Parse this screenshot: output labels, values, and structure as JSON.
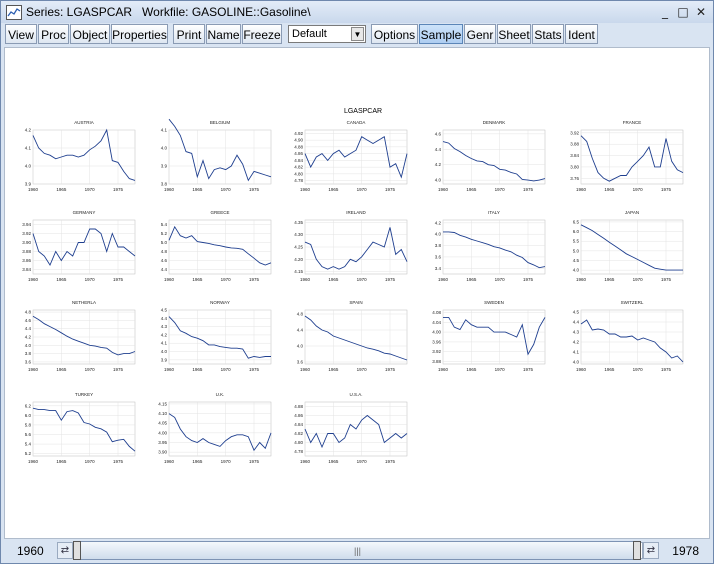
{
  "window": {
    "title": "Series: LGASPCAR   Workfile: GASOLINE::Gasoline\\",
    "minimize_glyph": "_",
    "maximize_glyph": "□",
    "close_glyph": "✕"
  },
  "toolbar": {
    "buttons": [
      {
        "label": "View"
      },
      {
        "label": "Proc"
      },
      {
        "label": "Object"
      },
      {
        "label": "Properties"
      },
      {
        "label": "Print"
      },
      {
        "label": "Name"
      },
      {
        "label": "Freeze"
      },
      {
        "label": "Options"
      },
      {
        "label": "Sample"
      },
      {
        "label": "Genr"
      },
      {
        "label": "Sheet"
      },
      {
        "label": "Stats"
      },
      {
        "label": "Ident"
      }
    ],
    "dropdown_value": "Default"
  },
  "chart_title": "LGASPCAR",
  "bottom": {
    "range_start": "1960",
    "range_end": "1978",
    "scroll_grip": "|||"
  },
  "chart_data": [
    {
      "type": "line",
      "title": "AUSTRIA",
      "x": [
        1960,
        1978
      ],
      "xticks": [
        "1960",
        "1965",
        "1970",
        "1975"
      ],
      "yticks": [
        "3.9",
        "4.0",
        "4.1",
        "4.2"
      ],
      "ylim": [
        3.9,
        4.2
      ],
      "values": [
        4.17,
        4.1,
        4.07,
        4.06,
        4.04,
        4.05,
        4.06,
        4.06,
        4.05,
        4.06,
        4.09,
        4.11,
        4.14,
        4.2,
        4.03,
        4.02,
        3.97,
        3.93,
        3.92
      ]
    },
    {
      "type": "line",
      "title": "BELGIUM",
      "x": [
        1960,
        1978
      ],
      "xticks": [
        "1960",
        "1965",
        "1970",
        "1975"
      ],
      "yticks": [
        "3.8",
        "3.9",
        "4.0",
        "4.1"
      ],
      "ylim": [
        3.8,
        4.1
      ],
      "values": [
        4.16,
        4.12,
        4.07,
        3.98,
        3.97,
        3.84,
        3.93,
        3.83,
        3.88,
        3.89,
        3.88,
        3.9,
        3.96,
        3.91,
        3.82,
        3.87,
        3.86,
        3.85,
        3.84
      ]
    },
    {
      "type": "line",
      "title": "CANADA",
      "x": [
        1960,
        1978
      ],
      "xticks": [
        "1960",
        "1965",
        "1970",
        "1975"
      ],
      "yticks": [
        "4.78",
        "4.80",
        "4.82",
        "4.84",
        "4.86",
        "4.88",
        "4.90",
        "4.92"
      ],
      "ylim": [
        4.77,
        4.93
      ],
      "values": [
        4.86,
        4.82,
        4.85,
        4.86,
        4.84,
        4.86,
        4.87,
        4.85,
        4.86,
        4.87,
        4.91,
        4.9,
        4.89,
        4.9,
        4.91,
        4.82,
        4.83,
        4.79,
        4.86
      ]
    },
    {
      "type": "line",
      "title": "DENMARK",
      "x": [
        1960,
        1978
      ],
      "xticks": [
        "1960",
        "1965",
        "1970",
        "1975"
      ],
      "yticks": [
        "4.0",
        "4.2",
        "4.4",
        "4.6"
      ],
      "ylim": [
        3.95,
        4.65
      ],
      "values": [
        4.5,
        4.48,
        4.41,
        4.37,
        4.32,
        4.28,
        4.25,
        4.24,
        4.2,
        4.19,
        4.14,
        4.13,
        4.1,
        4.08,
        4.01,
        4.0,
        3.99,
        4.0,
        4.02
      ]
    },
    {
      "type": "line",
      "title": "FRANCE",
      "x": [
        1960,
        1978
      ],
      "xticks": [
        "1960",
        "1965",
        "1970",
        "1975"
      ],
      "yticks": [
        "3.76",
        "3.80",
        "3.84",
        "3.88",
        "3.92"
      ],
      "ylim": [
        3.74,
        3.93
      ],
      "values": [
        3.91,
        3.89,
        3.83,
        3.78,
        3.76,
        3.75,
        3.76,
        3.77,
        3.77,
        3.8,
        3.82,
        3.84,
        3.87,
        3.8,
        3.8,
        3.9,
        3.82,
        3.79,
        3.78
      ]
    },
    {
      "type": "line",
      "title": "GERMANY",
      "x": [
        1960,
        1978
      ],
      "xticks": [
        "1960",
        "1965",
        "1970",
        "1975"
      ],
      "yticks": [
        "3.84",
        "3.86",
        "3.88",
        "3.90",
        "3.92",
        "3.94"
      ],
      "ylim": [
        3.83,
        3.95
      ],
      "values": [
        3.92,
        3.88,
        3.87,
        3.85,
        3.88,
        3.86,
        3.88,
        3.87,
        3.9,
        3.9,
        3.93,
        3.93,
        3.92,
        3.88,
        3.92,
        3.89,
        3.89,
        3.88,
        3.87
      ]
    },
    {
      "type": "line",
      "title": "GREECE",
      "x": [
        1960,
        1978
      ],
      "xticks": [
        "1960",
        "1965",
        "1970",
        "1975"
      ],
      "yticks": [
        "4.4",
        "4.6",
        "4.8",
        "5.0",
        "5.2",
        "5.4"
      ],
      "ylim": [
        4.3,
        5.5
      ],
      "values": [
        5.05,
        5.35,
        5.15,
        5.1,
        5.15,
        5.02,
        5.0,
        4.98,
        4.95,
        4.93,
        4.9,
        4.88,
        4.87,
        4.85,
        4.75,
        4.65,
        4.55,
        4.5,
        4.55
      ]
    },
    {
      "type": "line",
      "title": "IRELAND",
      "x": [
        1960,
        1978
      ],
      "xticks": [
        "1960",
        "1965",
        "1970",
        "1975"
      ],
      "yticks": [
        "4.15",
        "4.20",
        "4.25",
        "4.30",
        "4.35"
      ],
      "ylim": [
        4.14,
        4.36
      ],
      "values": [
        4.27,
        4.26,
        4.2,
        4.17,
        4.16,
        4.17,
        4.16,
        4.17,
        4.2,
        4.19,
        4.21,
        4.24,
        4.27,
        4.26,
        4.25,
        4.33,
        4.22,
        4.24,
        4.19
      ]
    },
    {
      "type": "line",
      "title": "ITALY",
      "x": [
        1960,
        1978
      ],
      "xticks": [
        "1960",
        "1965",
        "1970",
        "1975"
      ],
      "yticks": [
        "3.4",
        "3.6",
        "3.8",
        "4.0",
        "4.2"
      ],
      "ylim": [
        3.3,
        4.25
      ],
      "values": [
        4.04,
        4.04,
        4.03,
        3.98,
        3.95,
        3.91,
        3.88,
        3.85,
        3.82,
        3.78,
        3.76,
        3.72,
        3.69,
        3.63,
        3.59,
        3.5,
        3.46,
        3.41,
        3.43
      ]
    },
    {
      "type": "line",
      "title": "JAPAN",
      "x": [
        1960,
        1978
      ],
      "xticks": [
        "1960",
        "1965",
        "1970",
        "1975"
      ],
      "yticks": [
        "4.0",
        "4.5",
        "5.0",
        "5.5",
        "6.0",
        "6.5"
      ],
      "ylim": [
        3.8,
        6.6
      ],
      "values": [
        6.35,
        6.2,
        6.05,
        5.85,
        5.65,
        5.45,
        5.25,
        5.05,
        4.85,
        4.7,
        4.55,
        4.4,
        4.25,
        4.1,
        4.05,
        4.0,
        4.0,
        4.0,
        4.0
      ]
    },
    {
      "type": "line",
      "title": "NETHERLA",
      "x": [
        1960,
        1978
      ],
      "xticks": [
        "1960",
        "1965",
        "1970",
        "1975"
      ],
      "yticks": [
        "3.6",
        "3.8",
        "4.0",
        "4.2",
        "4.4",
        "4.6",
        "4.8"
      ],
      "ylim": [
        3.55,
        4.85
      ],
      "values": [
        4.7,
        4.62,
        4.52,
        4.45,
        4.38,
        4.3,
        4.22,
        4.15,
        4.1,
        4.05,
        4.0,
        3.98,
        3.95,
        3.93,
        3.83,
        3.77,
        3.8,
        3.8,
        3.85
      ]
    },
    {
      "type": "line",
      "title": "NORWAY",
      "x": [
        1960,
        1978
      ],
      "xticks": [
        "1960",
        "1965",
        "1970",
        "1975"
      ],
      "yticks": [
        "3.9",
        "4.0",
        "4.1",
        "4.2",
        "4.3",
        "4.4",
        "4.5"
      ],
      "ylim": [
        3.85,
        4.5
      ],
      "values": [
        4.42,
        4.35,
        4.25,
        4.22,
        4.18,
        4.16,
        4.13,
        4.08,
        4.08,
        4.06,
        4.05,
        4.04,
        4.04,
        4.03,
        3.92,
        3.94,
        3.93,
        3.94,
        3.94
      ]
    },
    {
      "type": "line",
      "title": "SPAIN",
      "x": [
        1960,
        1978
      ],
      "xticks": [
        "1960",
        "1965",
        "1970",
        "1975"
      ],
      "yticks": [
        "3.6",
        "4.0",
        "4.4",
        "4.8"
      ],
      "ylim": [
        3.55,
        4.9
      ],
      "values": [
        4.75,
        4.65,
        4.5,
        4.4,
        4.35,
        4.25,
        4.2,
        4.15,
        4.1,
        4.05,
        4.0,
        3.95,
        3.92,
        3.88,
        3.82,
        3.8,
        3.75,
        3.7,
        3.65
      ]
    },
    {
      "type": "line",
      "title": "SWEDEN",
      "x": [
        1960,
        1978
      ],
      "xticks": [
        "1960",
        "1965",
        "1970",
        "1975"
      ],
      "yticks": [
        "3.88",
        "3.92",
        "3.96",
        "4.00",
        "4.04",
        "4.08"
      ],
      "ylim": [
        3.87,
        4.09
      ],
      "values": [
        4.06,
        4.06,
        4.02,
        4.01,
        4.05,
        4.03,
        4.02,
        4.02,
        4.02,
        4.0,
        4.0,
        4.0,
        3.99,
        3.98,
        4.03,
        3.91,
        3.95,
        4.02,
        4.06
      ]
    },
    {
      "type": "line",
      "title": "SWITZERL",
      "x": [
        1960,
        1978
      ],
      "xticks": [
        "1960",
        "1965",
        "1970",
        "1975"
      ],
      "yticks": [
        "4.0",
        "4.1",
        "4.2",
        "4.3",
        "4.4",
        "4.5"
      ],
      "ylim": [
        3.98,
        4.52
      ],
      "values": [
        4.38,
        4.42,
        4.32,
        4.33,
        4.32,
        4.28,
        4.28,
        4.25,
        4.25,
        4.26,
        4.22,
        4.24,
        4.22,
        4.2,
        4.14,
        4.1,
        4.04,
        4.06,
        4.0
      ]
    },
    {
      "type": "line",
      "title": "TURKEY",
      "x": [
        1960,
        1978
      ],
      "xticks": [
        "1960",
        "1965",
        "1970",
        "1975"
      ],
      "yticks": [
        "5.2",
        "5.4",
        "5.6",
        "5.8",
        "6.0",
        "6.2"
      ],
      "ylim": [
        5.15,
        6.28
      ],
      "values": [
        6.15,
        6.12,
        6.12,
        6.1,
        6.1,
        5.9,
        6.08,
        6.1,
        6.05,
        5.85,
        5.82,
        5.75,
        5.72,
        5.65,
        5.45,
        5.48,
        5.5,
        5.35,
        5.25
      ]
    },
    {
      "type": "line",
      "title": "U.K.",
      "x": [
        1960,
        1978
      ],
      "xticks": [
        "1960",
        "1965",
        "1970",
        "1975"
      ],
      "yticks": [
        "3.90",
        "3.95",
        "4.00",
        "4.05",
        "4.10",
        "4.15"
      ],
      "ylim": [
        3.88,
        4.16
      ],
      "values": [
        4.1,
        4.08,
        4.02,
        3.98,
        3.96,
        3.95,
        3.97,
        3.95,
        3.94,
        3.93,
        3.96,
        3.98,
        3.99,
        3.99,
        3.98,
        3.91,
        3.95,
        3.92,
        4.0
      ]
    },
    {
      "type": "line",
      "title": "U.S.A.",
      "x": [
        1960,
        1978
      ],
      "xticks": [
        "1960",
        "1965",
        "1970",
        "1975"
      ],
      "yticks": [
        "4.78",
        "4.80",
        "4.82",
        "4.84",
        "4.86",
        "4.88"
      ],
      "ylim": [
        4.77,
        4.89
      ],
      "values": [
        4.83,
        4.8,
        4.82,
        4.79,
        4.82,
        4.82,
        4.8,
        4.81,
        4.84,
        4.83,
        4.85,
        4.86,
        4.85,
        4.84,
        4.8,
        4.81,
        4.82,
        4.81,
        4.82
      ]
    }
  ]
}
